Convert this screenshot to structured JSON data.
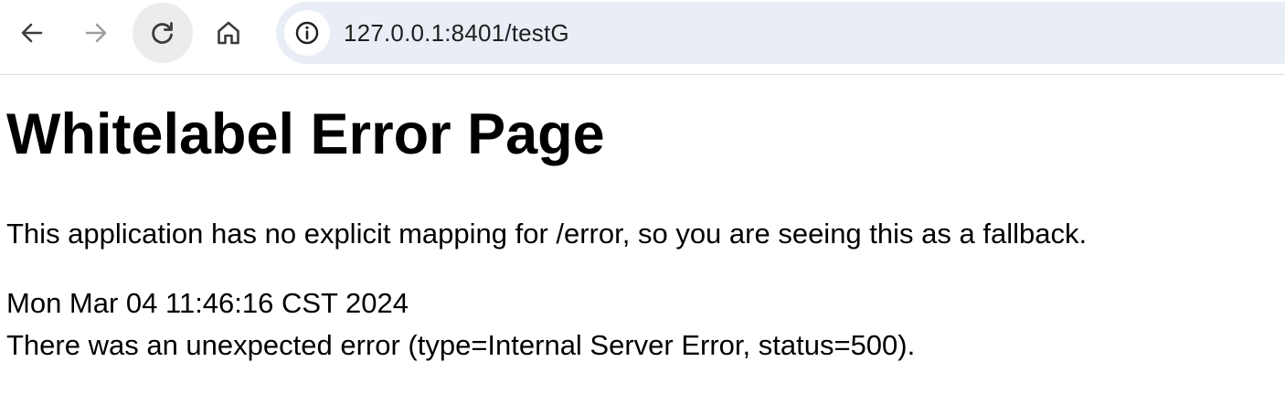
{
  "browser": {
    "nav": {
      "back_icon": "arrow-left-icon",
      "forward_icon": "arrow-right-icon",
      "reload_icon": "reload-icon",
      "home_icon": "home-icon"
    },
    "address_bar": {
      "site_info_icon": "info-circle-icon",
      "url": "127.0.0.1:8401/testG"
    },
    "colors": {
      "omnibox_bg": "#e9eef6",
      "reload_hover_bg": "#ececec",
      "forward_disabled": "#9e9e9e"
    }
  },
  "page": {
    "title": "Whitelabel Error Page",
    "explanation": "This application has no explicit mapping for /error, so you are seeing this as a fallback.",
    "timestamp": "Mon Mar 04 11:46:16 CST 2024",
    "error_detail": "There was an unexpected error (type=Internal Server Error, status=500)."
  }
}
